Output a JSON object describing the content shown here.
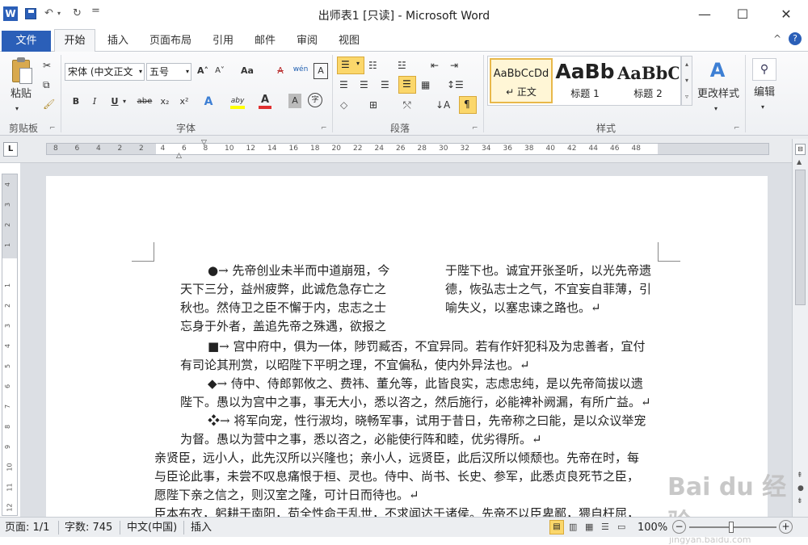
{
  "window": {
    "title": "出师表1 [只读] - Microsoft Word",
    "app_icon": "W",
    "undo_glyph": "↶",
    "redo_glyph": "↻",
    "qa_dropdown": "=",
    "minimize": "—",
    "maximize": "☐",
    "close": "✕"
  },
  "tabs": [
    {
      "label": "文件"
    },
    {
      "label": "开始"
    },
    {
      "label": "插入"
    },
    {
      "label": "页面布局"
    },
    {
      "label": "引用"
    },
    {
      "label": "邮件"
    },
    {
      "label": "审阅"
    },
    {
      "label": "视图"
    }
  ],
  "ribbon": {
    "clipboard": {
      "label": "剪贴板",
      "paste_label": "粘贴",
      "launcher": "⌐"
    },
    "font": {
      "label": "字体",
      "font_name": "宋体 (中文正文",
      "font_size": "五号",
      "grow": "A˄",
      "shrink": "A˅",
      "change_case": "Aa",
      "clear": "A",
      "pinyin": "wén",
      "border": "A",
      "bold": "B",
      "italic": "I",
      "underline": "U",
      "strike": "abe",
      "subscript": "x₂",
      "superscript": "x²",
      "effects": "A",
      "highlight": "aby",
      "color": "A",
      "shading": "A",
      "enclose": "字",
      "launcher": "⌐"
    },
    "paragraph": {
      "label": "段落",
      "launcher": "⌐"
    },
    "styles": {
      "label": "样式",
      "items": [
        {
          "preview": "AaBbCcDd",
          "name": "↵ 正文"
        },
        {
          "preview": "AaBb",
          "name": "标题 1"
        },
        {
          "preview": "AaBbC",
          "name": "标题 2"
        }
      ],
      "change_styles": "更改样式",
      "launcher": "⌐"
    },
    "editing": {
      "label": "编辑"
    },
    "minimize_ribbon": "^",
    "help": "?"
  },
  "ruler": {
    "corner": "L",
    "marks": [
      "8",
      "6",
      "4",
      "2",
      "2",
      "4",
      "6",
      "8",
      "10",
      "12",
      "14",
      "16",
      "18",
      "20",
      "22",
      "24",
      "26",
      "28",
      "30",
      "32",
      "34",
      "36",
      "38",
      "40",
      "42",
      "44",
      "46",
      "48"
    ]
  },
  "document": {
    "col1": [
      "●→ 先帝创业未半而中道崩殂，今",
      "天下三分，益州疲弊，此诚危急存亡之",
      "秋也。然侍卫之臣不懈于内，忠志之士",
      "忘身于外者，盖追先帝之殊遇，欲报之"
    ],
    "col2": [
      "于陛下也。诚宜开张圣听，以光先帝遗",
      "德，恢弘志士之气，不宜妄自菲薄，引",
      "喻失义，以塞忠谏之路也。↵"
    ],
    "paras": [
      "■→ 宫中府中，俱为一体，陟罚臧否，不宜异同。若有作奸犯科及为忠善者，宜付",
      "有司论其刑赏，以昭陛下平明之理，不宜偏私，使内外异法也。↵",
      "◆→ 侍中、侍郎郭攸之、费祎、董允等，此皆良实，志虑忠纯，是以先帝简拔以遗",
      "陛下。愚以为宫中之事，事无大小，悉以咨之，然后施行，必能裨补阙漏，有所广益。↵",
      "❖→ 将军向宠，性行淑均，晓畅军事，试用于昔日，先帝称之曰能，是以众议举宠",
      "为督。愚以为营中之事，悉以咨之，必能使行阵和睦，优劣得所。↵",
      "亲贤臣，远小人，此先汉所以兴隆也；亲小人，远贤臣，此后汉所以倾颓也。先帝在时，每",
      "与臣论此事，未尝不叹息痛恨于桓、灵也。侍中、尚书、长史、参军，此悉贞良死节之臣，",
      "愿陛下亲之信之，则汉室之隆，可计日而待也。↵",
      "臣本布衣，躬耕于南阳，苟全性命于乱世，不求闻达于诸侯。先帝不以臣卑鄙，猥自枉屈，"
    ]
  },
  "status": {
    "page": "页面: 1/1",
    "words": "字数: 745",
    "language": "中文(中国)",
    "mode": "插入",
    "zoom": "100%",
    "zoom_out": "−",
    "zoom_in": "+"
  },
  "watermark": "Bai du 经验",
  "watermark_sub": "jingyan.baidu.com"
}
